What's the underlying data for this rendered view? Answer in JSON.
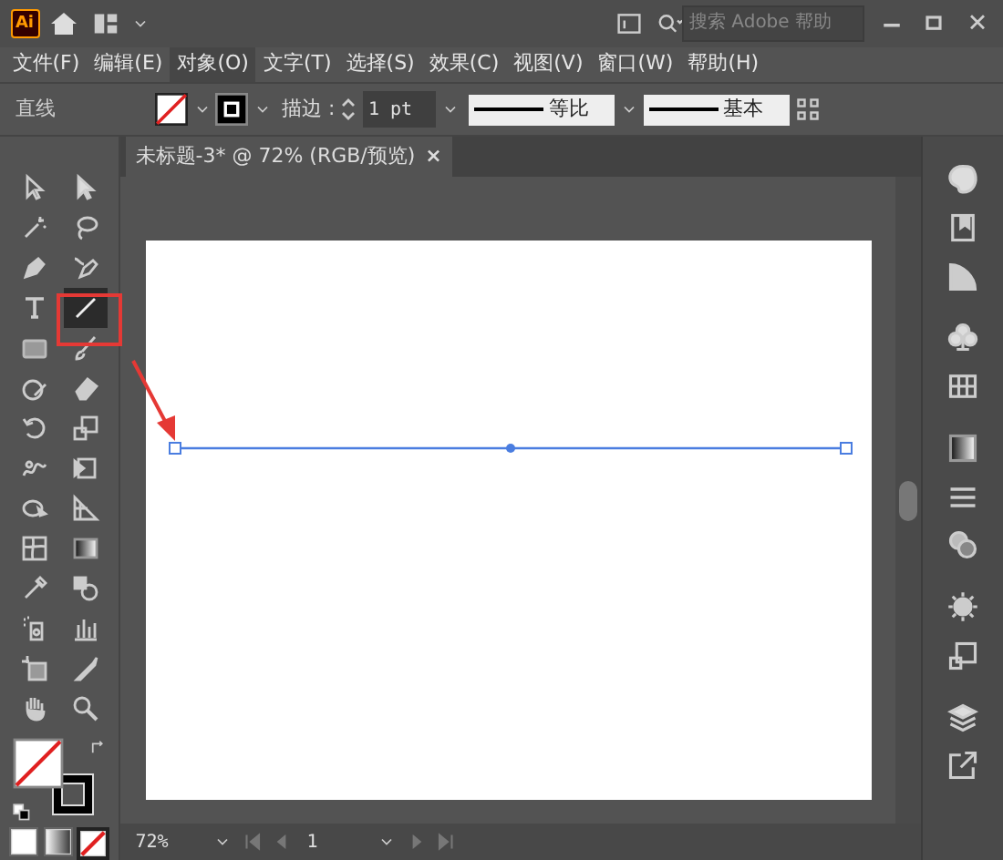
{
  "app": {
    "logo": "Ai"
  },
  "search": {
    "placeholder": "搜索 Adobe 帮助"
  },
  "menu": [
    {
      "label": "文件(F)",
      "selected": false
    },
    {
      "label": "编辑(E)",
      "selected": false
    },
    {
      "label": "对象(O)",
      "selected": true
    },
    {
      "label": "文字(T)",
      "selected": false
    },
    {
      "label": "选择(S)",
      "selected": false
    },
    {
      "label": "效果(C)",
      "selected": false
    },
    {
      "label": "视图(V)",
      "selected": false
    },
    {
      "label": "窗口(W)",
      "selected": false
    },
    {
      "label": "帮助(H)",
      "selected": false
    }
  ],
  "control_bar": {
    "object_type": "直线",
    "stroke_label": "描边 :",
    "stroke_weight": "1 pt",
    "profile_label": "等比",
    "brush_label": "基本"
  },
  "document_tab": {
    "title": "未标题-3* @ 72% (RGB/预览)",
    "close": "×"
  },
  "tools": [
    {
      "selected": false
    },
    {
      "selected": false
    },
    {
      "selected": false
    },
    {
      "selected": false
    },
    {
      "selected": false
    },
    {
      "selected": false
    },
    {
      "selected": false
    },
    {
      "selected": true
    },
    {
      "selected": false
    },
    {
      "selected": false
    },
    {
      "selected": false
    },
    {
      "selected": false
    },
    {
      "selected": false
    },
    {
      "selected": false
    },
    {
      "selected": false
    },
    {
      "selected": false
    },
    {
      "selected": false
    },
    {
      "selected": false
    },
    {
      "selected": false
    },
    {
      "selected": false
    },
    {
      "selected": false
    },
    {
      "selected": false
    },
    {
      "selected": false
    },
    {
      "selected": false
    },
    {
      "selected": false
    },
    {
      "selected": false
    },
    {
      "selected": false
    },
    {
      "selected": false
    }
  ],
  "fill_modes": [
    {
      "selected": false
    },
    {
      "selected": false
    },
    {
      "selected": true
    }
  ],
  "status_bar": {
    "zoom": "72%",
    "artboard": "1"
  }
}
